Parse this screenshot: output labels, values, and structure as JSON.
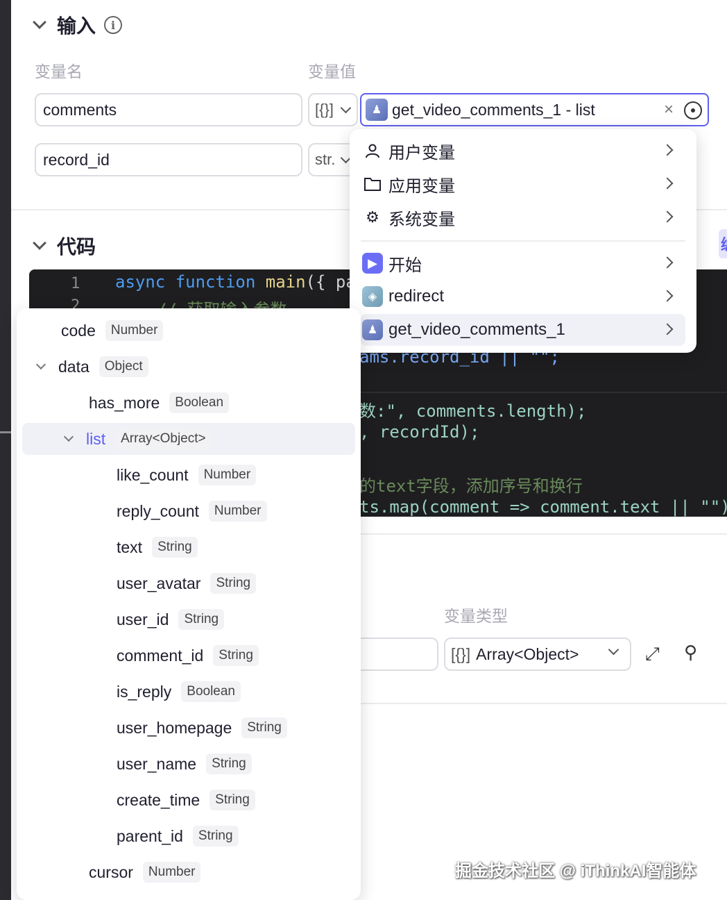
{
  "input_section": {
    "title": "输入",
    "col_name": "变量名",
    "col_value": "变量值",
    "rows": [
      {
        "name": "comments",
        "type": "[{}]"
      },
      {
        "name": "record_id",
        "type": "str."
      }
    ],
    "selected_value": "get_video_comments_1 - list",
    "clear_glyph": "×"
  },
  "code_section": {
    "title": "代码",
    "edit_label": "编",
    "line_numbers": [
      "1",
      "2"
    ],
    "lines": [
      {
        "kw": "async",
        "kw2": "function",
        "fn": "main",
        "rest": "({ par"
      },
      {
        "comment": "// 获取输入参数"
      },
      {
        "text": "ams.record_id || \"\";"
      },
      {
        "text": "数:\", comments.length);"
      },
      {
        "text": ", recordId);"
      },
      {
        "text": "的text字段，添加序号和换行"
      },
      {
        "text": "ts.map(comment => comment.text || \"\")"
      }
    ]
  },
  "output_section": {
    "col_type": "变量类型",
    "type_value": "Array<Object>",
    "type_prefix": "[{}]"
  },
  "var_menu": {
    "groups": [
      {
        "label": "用户变量",
        "icon": "user-icon"
      },
      {
        "label": "应用变量",
        "icon": "folder-icon"
      },
      {
        "label": "系统变量",
        "icon": "gear-icon"
      }
    ],
    "nodes": [
      {
        "label": "开始",
        "icon": "start-node-icon"
      },
      {
        "label": "redirect",
        "icon": "redirect-node-icon"
      },
      {
        "label": "get_video_comments_1",
        "icon": "plugin-node-icon",
        "selected": true
      }
    ]
  },
  "tree_menu": {
    "rows": [
      {
        "name": "code",
        "type": "Number",
        "depth": 1,
        "expandable": false
      },
      {
        "name": "data",
        "type": "Object",
        "depth": 1,
        "expandable": true
      },
      {
        "name": "has_more",
        "type": "Boolean",
        "depth": 2,
        "expandable": false
      },
      {
        "name": "list",
        "type": "Array<Object>",
        "depth": 2,
        "expandable": true,
        "selected": true
      },
      {
        "name": "like_count",
        "type": "Number",
        "depth": 3
      },
      {
        "name": "reply_count",
        "type": "Number",
        "depth": 3
      },
      {
        "name": "text",
        "type": "String",
        "depth": 3
      },
      {
        "name": "user_avatar",
        "type": "String",
        "depth": 3
      },
      {
        "name": "user_id",
        "type": "String",
        "depth": 3
      },
      {
        "name": "comment_id",
        "type": "String",
        "depth": 3
      },
      {
        "name": "is_reply",
        "type": "Boolean",
        "depth": 3
      },
      {
        "name": "user_homepage",
        "type": "String",
        "depth": 3
      },
      {
        "name": "user_name",
        "type": "String",
        "depth": 3
      },
      {
        "name": "create_time",
        "type": "String",
        "depth": 3
      },
      {
        "name": "parent_id",
        "type": "String",
        "depth": 3
      },
      {
        "name": "cursor",
        "type": "Number",
        "depth": 2
      }
    ]
  },
  "watermark": "掘金技术社区 @ iThinkAI智能体",
  "colors": {
    "accent": "#5d5ff0",
    "code_bg": "#1e1e20",
    "selected_bg": "#f0f1f6"
  }
}
